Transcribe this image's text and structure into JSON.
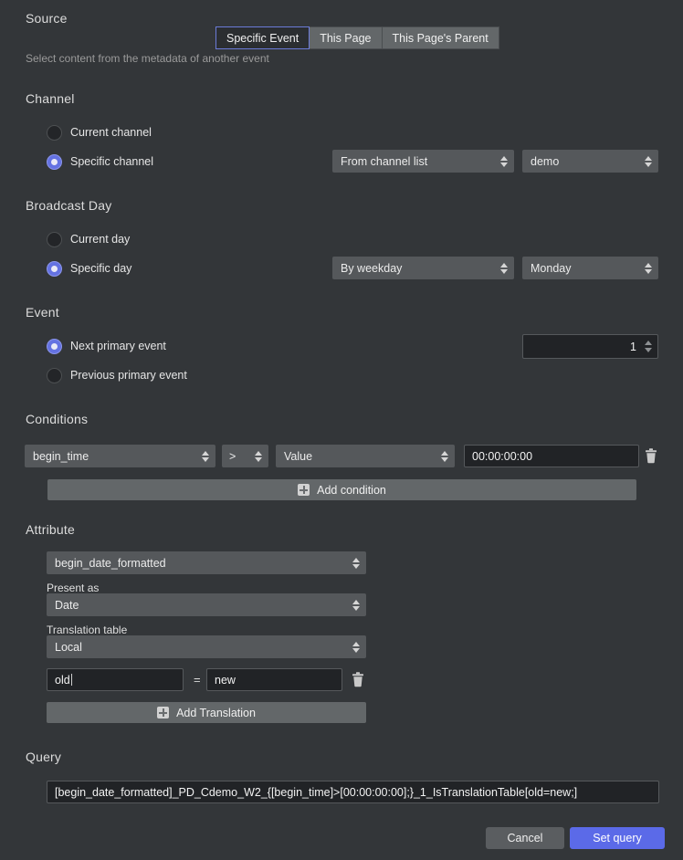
{
  "source": {
    "title": "Source",
    "tabs": [
      {
        "label": "Specific Event",
        "active": true
      },
      {
        "label": "This Page",
        "active": false
      },
      {
        "label": "This Page's Parent",
        "active": false
      }
    ],
    "hint": "Select content from the metadata of another event"
  },
  "channel": {
    "title": "Channel",
    "options": [
      {
        "label": "Current channel",
        "selected": false
      },
      {
        "label": "Specific channel",
        "selected": true
      }
    ],
    "mode_select": "From channel list",
    "value_select": "demo"
  },
  "broadcast_day": {
    "title": "Broadcast Day",
    "options": [
      {
        "label": "Current day",
        "selected": false
      },
      {
        "label": "Specific day",
        "selected": true
      }
    ],
    "mode_select": "By weekday",
    "value_select": "Monday"
  },
  "event": {
    "title": "Event",
    "options": [
      {
        "label": "Next primary event",
        "selected": true
      },
      {
        "label": "Previous primary event",
        "selected": false
      }
    ],
    "count_value": "1"
  },
  "conditions": {
    "title": "Conditions",
    "rows": [
      {
        "field": "begin_time",
        "operator": ">",
        "compare_type": "Value",
        "value": "00:00:00:00"
      }
    ],
    "add_label": "Add condition"
  },
  "attribute": {
    "title": "Attribute",
    "attribute_select": "begin_date_formatted",
    "present_as_label": "Present as",
    "present_as_select": "Date",
    "translation_table_label": "Translation table",
    "translation_table_select": "Local",
    "translations": [
      {
        "old": "old",
        "equals": "=",
        "new": "new"
      }
    ],
    "add_label": "Add Translation"
  },
  "query": {
    "title": "Query",
    "value": "[begin_date_formatted]_PD_Cdemo_W2_{[begin_time]>[00:00:00:00];}_1_IsTranslationTable[old=new;]"
  },
  "footer": {
    "cancel_label": "Cancel",
    "confirm_label": "Set query"
  },
  "colors": {
    "background": "#333639",
    "accent": "#5b6ae8",
    "radio_on": "#6472e2",
    "control": "#55585b",
    "input_bg": "#212326"
  }
}
